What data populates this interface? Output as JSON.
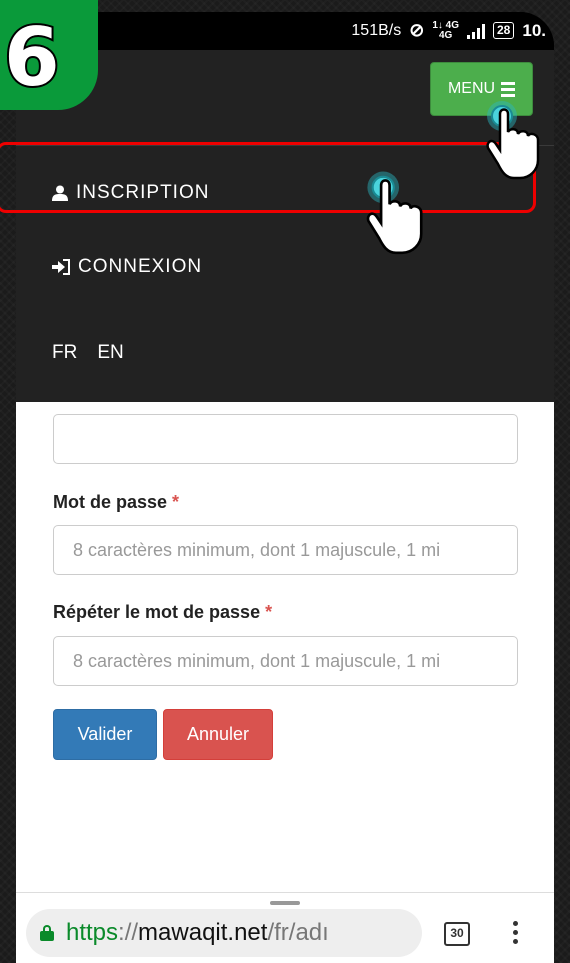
{
  "status_bar": {
    "speed": "151B/s",
    "network_top": "1↓ 4G",
    "network_bottom": "4G",
    "battery": "28",
    "clock": "10."
  },
  "tutorial": {
    "step_number": "6",
    "highlight_color": "#e00000",
    "badge_color": "#0a9a3a"
  },
  "navbar": {
    "menu_label": "MENU"
  },
  "dropdown": {
    "items": [
      {
        "label": "INSCRIPTION",
        "icon": "user-icon"
      },
      {
        "label": "CONNEXION",
        "icon": "sign-in-icon"
      }
    ],
    "languages": [
      "FR",
      "EN"
    ]
  },
  "form": {
    "email_value": "",
    "password_label": "Mot de passe",
    "password_placeholder": "8 caractères minimum, dont 1 majuscule, 1 mi",
    "password_repeat_label": "Répéter le mot de passe",
    "password_repeat_placeholder": "8 caractères minimum, dont 1 majuscule, 1 mi",
    "required_mark": "*",
    "submit_label": "Valider",
    "cancel_label": "Annuler"
  },
  "browser": {
    "url_scheme": "https",
    "url_sep": "://",
    "url_host": "mawaqit.net",
    "url_path": "/fr/adı",
    "tab_count": "30"
  },
  "colors": {
    "menu_button": "#4cae4c",
    "primary_button": "#337ab7",
    "danger_button": "#d9534f",
    "navbar_bg": "#222222"
  }
}
